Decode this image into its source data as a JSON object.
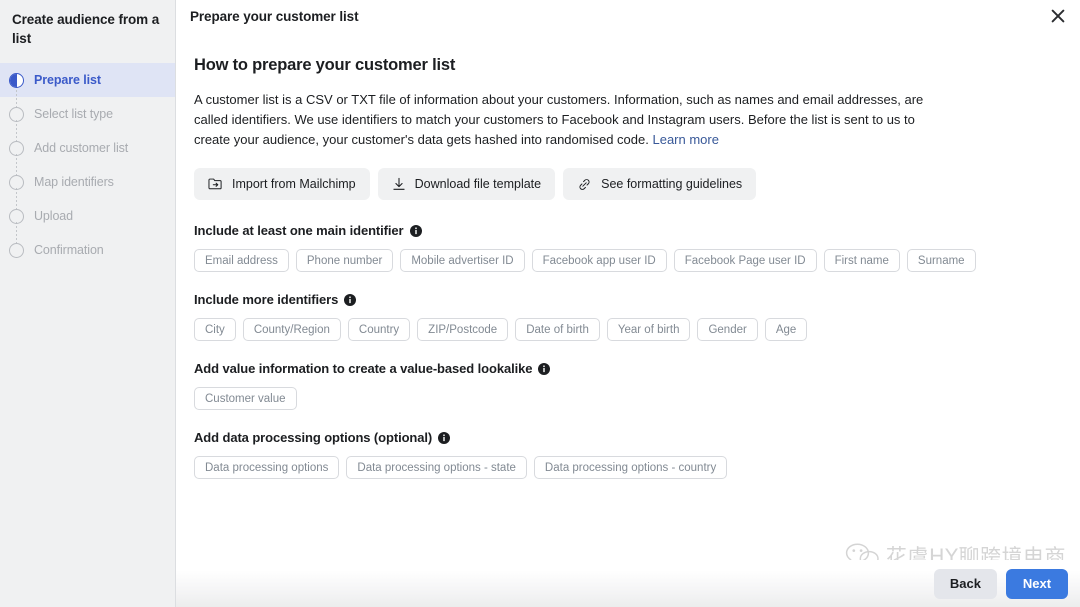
{
  "sidebar": {
    "title": "Create audience from a list",
    "steps": [
      {
        "label": "Prepare list",
        "state": "active",
        "icon": "half-filled-circle-icon"
      },
      {
        "label": "Select list type",
        "state": "pending",
        "icon": "empty-circle-icon"
      },
      {
        "label": "Add customer list",
        "state": "pending",
        "icon": "empty-circle-icon"
      },
      {
        "label": "Map identifiers",
        "state": "pending",
        "icon": "empty-circle-icon"
      },
      {
        "label": "Upload",
        "state": "pending",
        "icon": "empty-circle-icon"
      },
      {
        "label": "Confirmation",
        "state": "pending",
        "icon": "empty-circle-icon"
      }
    ]
  },
  "header": {
    "title": "Prepare your customer list",
    "close_icon": "close-icon"
  },
  "main": {
    "section_heading": "How to prepare your customer list",
    "intro_text": "A customer list is a CSV or TXT file of information about your customers. Information, such as names and email addresses, are called identifiers. We use identifiers to match your customers to Facebook and Instagram users. Before the list is sent to us to create your audience, your customer's data gets hashed into randomised code. ",
    "learn_more_label": "Learn more",
    "actions": [
      {
        "label": "Import from Mailchimp",
        "icon": "folder-import-icon"
      },
      {
        "label": "Download file template",
        "icon": "download-icon"
      },
      {
        "label": "See formatting guidelines",
        "icon": "link-icon"
      }
    ],
    "groups": [
      {
        "title": "Include at least one main identifier",
        "info_icon": "info-icon",
        "chips": [
          "Email address",
          "Phone number",
          "Mobile advertiser ID",
          "Facebook app user ID",
          "Facebook Page user ID",
          "First name",
          "Surname"
        ]
      },
      {
        "title": "Include more identifiers",
        "info_icon": "info-icon",
        "chips": [
          "City",
          "County/Region",
          "Country",
          "ZIP/Postcode",
          "Date of birth",
          "Year of birth",
          "Gender",
          "Age"
        ]
      },
      {
        "title": "Add value information to create a value-based lookalike",
        "info_icon": "info-icon",
        "chips": [
          "Customer value"
        ]
      },
      {
        "title": "Add data processing options (optional)",
        "info_icon": "info-icon",
        "chips": [
          "Data processing options",
          "Data processing options - state",
          "Data processing options - country"
        ]
      }
    ]
  },
  "footer": {
    "back_label": "Back",
    "next_label": "Next"
  },
  "watermark": {
    "text": "花虞HY聊跨境电商",
    "icon": "wechat-icon"
  },
  "colors": {
    "accent": "#3b5ac9",
    "primary_button": "#3b7ae0",
    "link": "#385898",
    "sidebar_bg": "#f0f1f2",
    "chip_border": "#d8dade",
    "chip_text": "#828a93"
  }
}
